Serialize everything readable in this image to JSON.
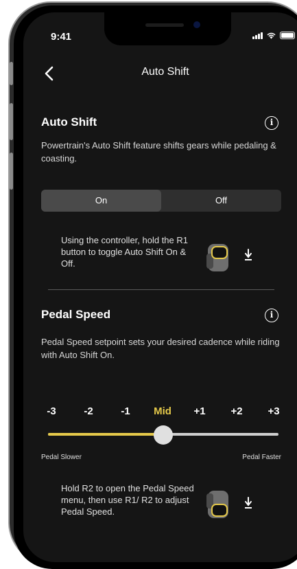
{
  "status": {
    "time": "9:41"
  },
  "nav": {
    "title": "Auto Shift"
  },
  "auto_shift": {
    "title": "Auto Shift",
    "info_icon": "i",
    "description": "Powertrain's Auto Shift feature shifts gears while pedaling & coasting.",
    "toggle": {
      "on_label": "On",
      "off_label": "Off",
      "selected": "On"
    },
    "hint": "Using the controller, hold the R1 button to toggle Auto Shift On & Off."
  },
  "pedal_speed": {
    "title": "Pedal Speed",
    "info_icon": "i",
    "description": "Pedal Speed setpoint sets your desired cadence while riding with Auto Shift On.",
    "scale": [
      "-3",
      "-2",
      "-1",
      "Mid",
      "+1",
      "+2",
      "+3"
    ],
    "selected": "Mid",
    "slider_fraction": 0.5,
    "label_left": "Pedal Slower",
    "label_right": "Pedal Faster",
    "hint": "Hold R2 to open the Pedal Speed menu, then use R1/ R2 to adjust Pedal Speed."
  },
  "colors": {
    "accent": "#e5c94a",
    "background": "#151515"
  }
}
